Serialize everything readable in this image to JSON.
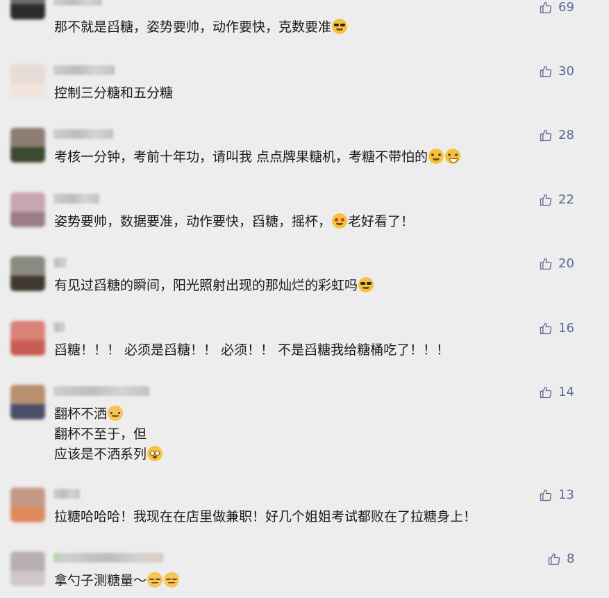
{
  "comments": [
    {
      "text_lines": [
        "那不就是舀糖，姿势要帅，动作要快，克数要准"
      ],
      "emoji": "cool",
      "likes": "69"
    },
    {
      "text_lines": [
        "控制三分糖和五分糖"
      ],
      "emoji": "",
      "likes": "30"
    },
    {
      "text_lines": [
        "考核一分钟，考前十年功，请叫我 点点牌果糖机，考糖不带怕的"
      ],
      "emoji": "think-grin",
      "likes": "28"
    },
    {
      "text_lines": [
        "姿势要帅，数据要准，动作要快，舀糖，摇杯，",
        "老好看了！"
      ],
      "emoji": "heart-eyes",
      "likes": "22"
    },
    {
      "text_lines": [
        "有见过舀糖的瞬间，阳光照射出现的那灿烂的彩虹吗"
      ],
      "emoji": "cool",
      "likes": "20"
    },
    {
      "text_lines": [
        "舀糖！！！ 必须是舀糖！！ 必须！！ 不是舀糖我给糖桶吃了！！！"
      ],
      "emoji": "",
      "likes": "16"
    },
    {
      "text_lines": [
        "翻杯不洒",
        "翻杯不至于，但",
        "应该是不洒系列"
      ],
      "emoji": "cat-dizzy",
      "likes": "14"
    },
    {
      "text_lines": [
        "拉糖哈哈哈！我现在在店里做兼职！好几个姐姐考试都败在了拉糖身上！"
      ],
      "emoji": "",
      "likes": "13"
    },
    {
      "text_lines": [
        "拿勺子测糖量～"
      ],
      "emoji": "cat-cat",
      "likes": "8"
    }
  ],
  "icons": {
    "like": "thumbs-up-icon"
  },
  "colors": {
    "like": "#576b95",
    "text": "#1a1a1a",
    "background": "#ededed"
  }
}
